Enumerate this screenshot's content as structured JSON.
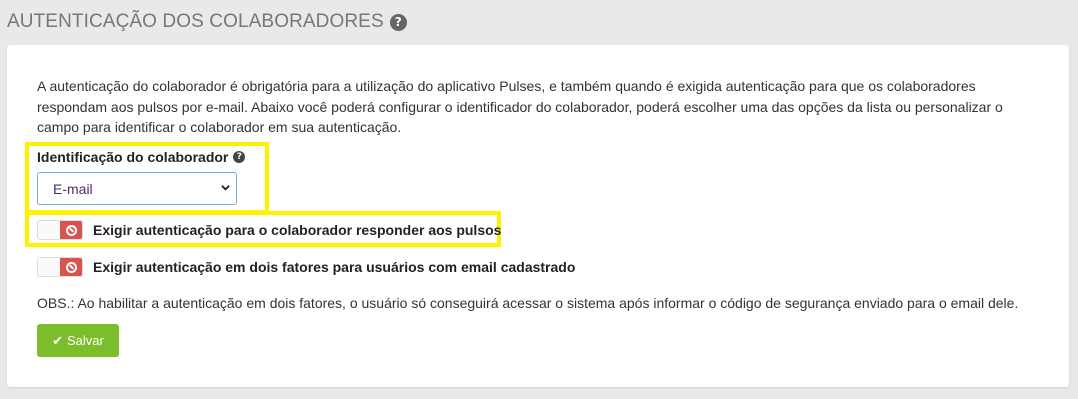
{
  "page": {
    "title": "AUTENTICAÇÃO DOS COLABORADORES",
    "title_help_icon": "question-circle"
  },
  "description": "A autenticação do colaborador é obrigatória para a utilização do aplicativo Pulses, e também quando é exigida autenticação para que os colaboradores respondam aos pulsos por e-mail. Abaixo você poderá configurar o identificador do colaborador, poderá escolher uma das opções da lista ou personalizar o campo para identificar o colaborador em sua autenticação.",
  "identifier_field": {
    "label": "Identificação do colaborador",
    "help_icon": "question-circle",
    "selected_value": "E-mail",
    "dropdown_icon": "chevron-down"
  },
  "toggles": [
    {
      "label": "Exigir autenticação para o colaborador responder aos pulsos",
      "state": "off",
      "icon": "ban-icon"
    },
    {
      "label": "Exigir autenticação em dois fatores para usuários com email cadastrado",
      "state": "off",
      "icon": "ban-icon"
    }
  ],
  "obs": "OBS.: Ao habilitar a autenticação em dois fatores, o usuário só conseguirá acessar o sistema após informar o código de segurança enviado para o email dele.",
  "save_button": {
    "label": "Salvar",
    "icon": "check-icon"
  },
  "colors": {
    "highlight": "#fff200",
    "toggle_off": "#d9534f",
    "save_button": "#7cbd2b",
    "select_border": "#7aaed6"
  }
}
